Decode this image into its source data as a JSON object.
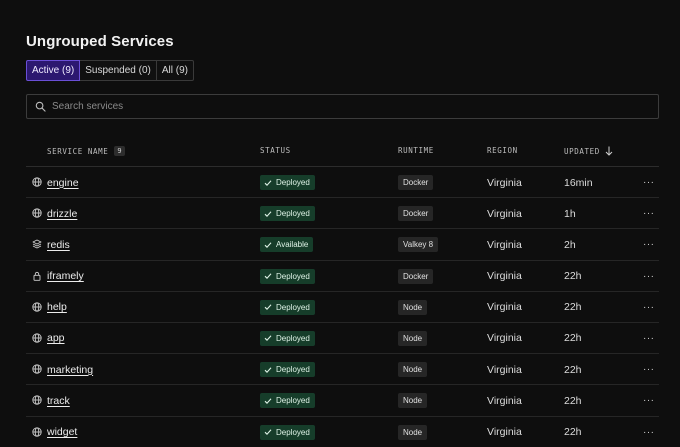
{
  "page": {
    "title": "Ungrouped Services"
  },
  "tabs": [
    {
      "label": "Active (9)",
      "active": true
    },
    {
      "label": "Suspended (0)",
      "active": false
    },
    {
      "label": "All (9)",
      "active": false
    }
  ],
  "search": {
    "placeholder": "Search services",
    "value": ""
  },
  "table": {
    "columns": {
      "service_name": "SERVICE NAME",
      "service_count": "9",
      "status": "STATUS",
      "runtime": "RUNTIME",
      "region": "REGION",
      "updated": "UPDATED"
    },
    "more_label": "···",
    "rows": [
      {
        "icon": "globe-icon",
        "name": "engine",
        "status": "Deployed",
        "runtime": "Docker",
        "region": "Virginia",
        "updated": "16min"
      },
      {
        "icon": "globe-icon",
        "name": "drizzle",
        "status": "Deployed",
        "runtime": "Docker",
        "region": "Virginia",
        "updated": "1h"
      },
      {
        "icon": "layers-icon",
        "name": "redis",
        "status": "Available",
        "runtime": "Valkey 8",
        "region": "Virginia",
        "updated": "2h"
      },
      {
        "icon": "lock-icon",
        "name": "iframely",
        "status": "Deployed",
        "runtime": "Docker",
        "region": "Virginia",
        "updated": "22h"
      },
      {
        "icon": "globe-icon",
        "name": "help",
        "status": "Deployed",
        "runtime": "Node",
        "region": "Virginia",
        "updated": "22h"
      },
      {
        "icon": "globe-icon",
        "name": "app",
        "status": "Deployed",
        "runtime": "Node",
        "region": "Virginia",
        "updated": "22h"
      },
      {
        "icon": "globe-icon",
        "name": "marketing",
        "status": "Deployed",
        "runtime": "Node",
        "region": "Virginia",
        "updated": "22h"
      },
      {
        "icon": "globe-icon",
        "name": "track",
        "status": "Deployed",
        "runtime": "Node",
        "region": "Virginia",
        "updated": "22h"
      },
      {
        "icon": "globe-icon",
        "name": "widget",
        "status": "Deployed",
        "runtime": "Node",
        "region": "Virginia",
        "updated": "22h"
      }
    ]
  },
  "colors": {
    "background": "#0e0e0e",
    "active_tab": "#2c1870",
    "status_badge": "#163d2a",
    "runtime_badge": "#262626"
  }
}
